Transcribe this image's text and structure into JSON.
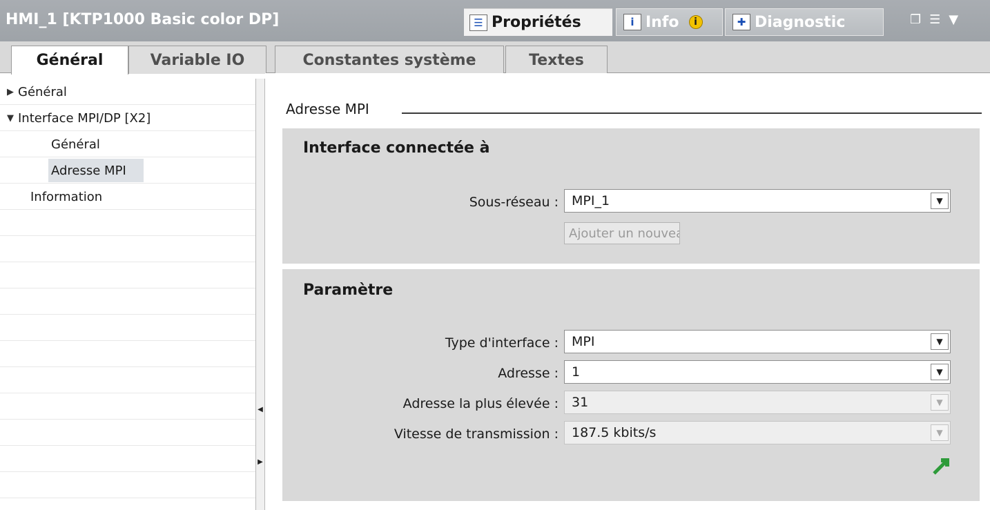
{
  "window": {
    "title": "HMI_1 [KTP1000 Basic color DP]",
    "tabs": {
      "properties": "Propriétés",
      "info": "Info",
      "diagnostic": "Diagnostic"
    },
    "controls": [
      "❐",
      "☰",
      "▼"
    ]
  },
  "category_tabs": [
    "Général",
    "Variable IO",
    "Constantes système",
    "Textes"
  ],
  "tree": {
    "general": "Général",
    "interface": "Interface MPI/DP [X2]",
    "interface_general": "Général",
    "mpi_address": "Adresse MPI",
    "information": "Information"
  },
  "panel": {
    "section_title": "Adresse MPI",
    "interface_group": {
      "title": "Interface connectée à",
      "subnet_label": "Sous-réseau :",
      "subnet_value": "MPI_1",
      "add_button": "Ajouter un nouveau sous-ré..."
    },
    "param_group": {
      "title": "Paramètre",
      "type_label": "Type d'interface :",
      "type_value": "MPI",
      "address_label": "Adresse :",
      "address_value": "1",
      "highest_label": "Adresse la plus élevée :",
      "highest_value": "31",
      "speed_label": "Vitesse de transmission :",
      "speed_value": "187.5 kbits/s"
    }
  },
  "colors": {
    "accent_green": "#2e9b3a",
    "selected": "#dde1e6",
    "group_bg": "#d9d9d9"
  }
}
